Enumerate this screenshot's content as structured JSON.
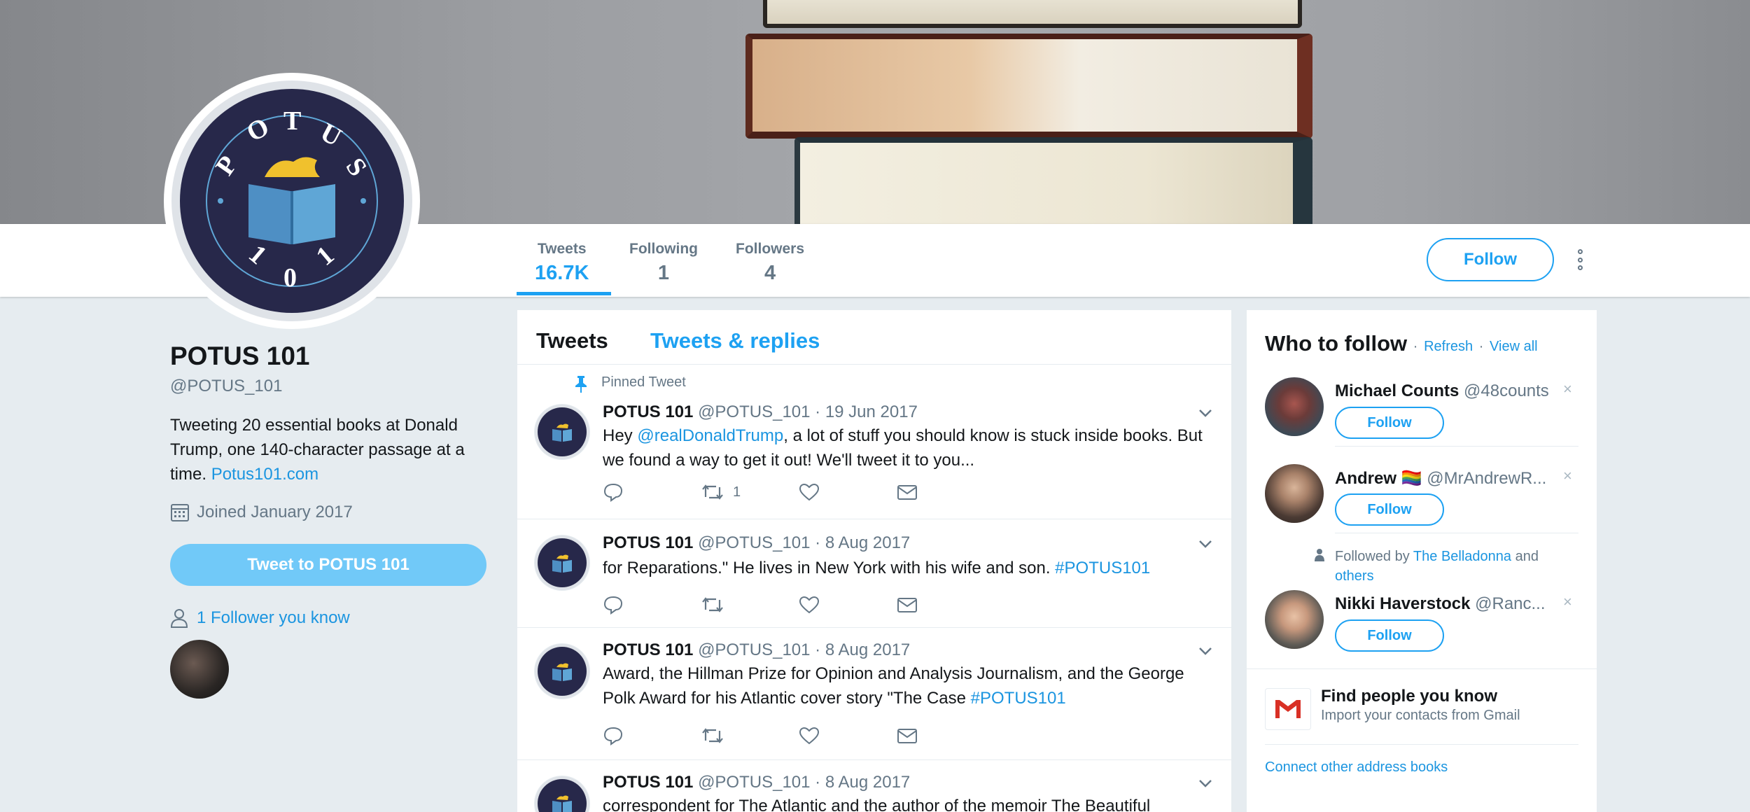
{
  "nav": {
    "stats": [
      {
        "label": "Tweets",
        "value": "16.7K"
      },
      {
        "label": "Following",
        "value": "1"
      },
      {
        "label": "Followers",
        "value": "4"
      }
    ],
    "follow_label": "Follow"
  },
  "profile": {
    "avatar_letters_top": [
      "P",
      "O",
      "T",
      "U",
      "S"
    ],
    "avatar_letters_bottom": [
      "1",
      "0",
      "1"
    ],
    "name": "POTUS 101",
    "handle": "@POTUS_101",
    "bio": "Tweeting 20 essential books at Donald Trump, one 140-character passage at a time.",
    "bio_link": "Potus101.com",
    "joined": "Joined January 2017",
    "tweet_to_label": "Tweet to POTUS 101",
    "followers_you_know": "1 Follower you know"
  },
  "timeline": {
    "tabs": [
      "Tweets",
      "Tweets & replies"
    ],
    "pinned_label": "Pinned Tweet",
    "tweets": [
      {
        "name": "POTUS 101",
        "meta": "@POTUS_101 · 19 Jun 2017",
        "text_pre": "Hey ",
        "mention": "@realDonaldTrump",
        "text_post": ", a lot of stuff you should know is stuck inside books. But we found a way to get it out! We'll tweet it to you...",
        "retweets": "1"
      },
      {
        "name": "POTUS 101",
        "meta": "@POTUS_101 · 8 Aug 2017",
        "text": "for Reparations.\" He lives in New York with his wife and son. ",
        "hashtag": "#POTUS101"
      },
      {
        "name": "POTUS 101",
        "meta": "@POTUS_101 · 8 Aug 2017",
        "text": "Award, the Hillman Prize for Opinion and Analysis Journalism, and the George Polk Award for his Atlantic cover story \"The Case ",
        "hashtag": "#POTUS101"
      },
      {
        "name": "POTUS 101",
        "meta": "@POTUS_101 · 8 Aug 2017",
        "text": "correspondent for The Atlantic and the author of the memoir The Beautiful"
      }
    ]
  },
  "who_to_follow": {
    "title": "Who to follow",
    "refresh": "Refresh",
    "view_all": "View all",
    "dot": "·",
    "follow_label": "Follow",
    "close_glyph": "×",
    "users": [
      {
        "name": "Michael Counts",
        "handle": "@48counts"
      },
      {
        "name": "Andrew",
        "flag": "🏳️‍🌈",
        "handle": "@MrAndrewR..."
      },
      {
        "name": "Nikki Haverstock",
        "handle": "@Ranc..."
      }
    ],
    "followed_by_pre": "Followed by ",
    "followed_by_link": "The Belladonna",
    "followed_by_and": " and ",
    "followed_by_others": "others",
    "find_title": "Find people you know",
    "find_sub": "Import your contacts from Gmail",
    "connect": "Connect other address books"
  }
}
